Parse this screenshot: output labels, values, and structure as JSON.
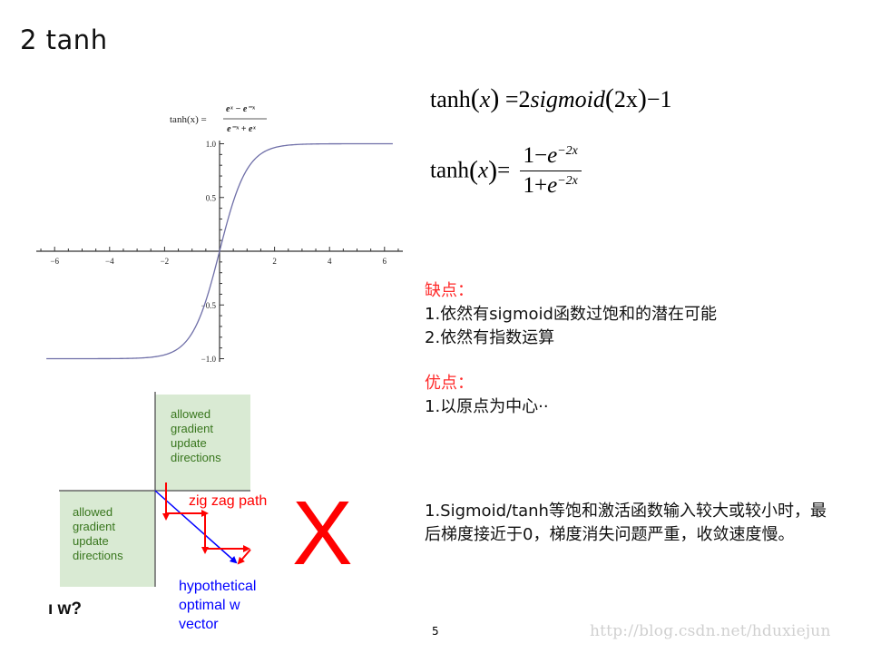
{
  "slide": {
    "title": "2 tanh",
    "page_number": "5",
    "watermark": "http://blog.csdn.net/hduxiejun"
  },
  "plot": {
    "formula_label": "tanh(x) =",
    "formula_numerator": "eˣ − e⁻ˣ",
    "formula_denominator": "e⁻ˣ + eˣ",
    "curve_color": "#6f6fa8"
  },
  "chart_data": {
    "type": "line",
    "title": "tanh(x) = (e^x - e^-x)/(e^-x + e^x)",
    "xlabel": "",
    "ylabel": "",
    "xlim": [
      -6.3,
      6.3
    ],
    "ylim": [
      -1.0,
      1.0
    ],
    "x_ticks": [
      -6,
      -4,
      -2,
      2,
      4,
      6
    ],
    "x_tick_labels": [
      "−6",
      "−4",
      "−2",
      "2",
      "4",
      "6"
    ],
    "y_ticks": [
      1.0,
      0.5,
      -0.5,
      -1.0
    ],
    "y_tick_labels": [
      "1.0",
      "0.5",
      "−0.5",
      "−1.0"
    ],
    "grid": false,
    "series": [
      {
        "name": "tanh(x)",
        "function": "tanh",
        "x_range": [
          -6.3,
          6.3
        ]
      }
    ]
  },
  "formulas": {
    "f1": {
      "lhs_fn": "tanh",
      "lhs_arg": "x",
      "eq": "=",
      "coef": "2",
      "fn": "sigmoid",
      "arg": "2x",
      "tail": "−1"
    },
    "f2": {
      "lhs_fn": "tanh",
      "lhs_arg": "x",
      "eq": "=",
      "num_const": "1−",
      "den_const": "1+",
      "base": "e",
      "exp": "−2x"
    }
  },
  "cons": {
    "heading": "缺点：",
    "items": [
      "1.依然有sigmoid函数过饱和的潜在可能",
      "2.依然有指数运算"
    ]
  },
  "pros": {
    "heading": "优点：",
    "items": [
      "1.以原点为中心··"
    ]
  },
  "note": {
    "text": "1.Sigmoid/tanh等饱和激活函数输入较大或较小时，最后梯度接近于0，梯度消失问题严重，收敛速度慢。"
  },
  "diagram": {
    "upper_box_lines": [
      "allowed",
      "gradient",
      "update",
      "directions"
    ],
    "lower_box_lines": [
      "allowed",
      "gradient",
      "update",
      "directions"
    ],
    "zigzag_label": "zig zag path",
    "optimal_lines": [
      "hypothetical",
      "optimal w",
      "vector"
    ],
    "cutoff_text": "ı w?",
    "cross_mark": "X",
    "colors": {
      "box_fill": "#d9ead3",
      "box_text": "#38761d",
      "zigzag": "#ff0000",
      "optimal": "#0000ff",
      "cross": "#ff0000"
    }
  }
}
